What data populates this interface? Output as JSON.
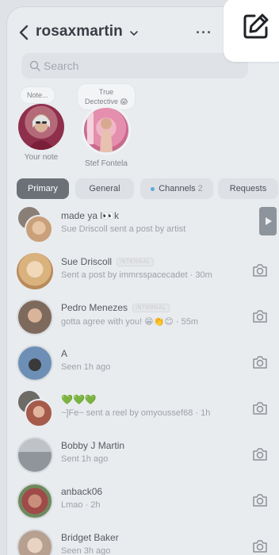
{
  "header": {
    "username": "rosaxmartin",
    "more_label": "···"
  },
  "search": {
    "placeholder": "Search"
  },
  "notes": [
    {
      "bubble": "Note...",
      "label": "Your note"
    },
    {
      "bubble": "True Dectective 😱",
      "label": "Stef Fontela"
    }
  ],
  "tabs": [
    {
      "label": "Primary",
      "active": true
    },
    {
      "label": "General"
    },
    {
      "label": "Channels",
      "count": "2"
    },
    {
      "label": "Requests"
    }
  ],
  "threads": [
    {
      "name": "made ya l👀k",
      "sub": "Sue Driscoll sent a post by artist",
      "badge": ""
    },
    {
      "name": "Sue Driscoll",
      "sub": "Sent a post by immrsspacecadet · 30m",
      "badge": "INTERNAL"
    },
    {
      "name": "Pedro Menezes",
      "sub": "gotta agree with you! 😁👏😊 · 55m",
      "badge": "INTERNAL"
    },
    {
      "name": "A",
      "sub": "Seen 1h ago",
      "badge": ""
    },
    {
      "name": "💚💚💚",
      "sub": "~]Fe~ sent a reel by omyoussef68 · 1h",
      "badge": ""
    },
    {
      "name": "Bobby J Martin",
      "sub": "Sent 1h ago",
      "badge": ""
    },
    {
      "name": "anback06",
      "sub": "Lmao · 2h",
      "badge": ""
    },
    {
      "name": "Bridget Baker",
      "sub": "Seen 3h ago",
      "badge": ""
    }
  ],
  "colors": {
    "accent_tab": "#6c7178",
    "channel_dot": "#5fa7e0",
    "background": "#e9ecef"
  }
}
